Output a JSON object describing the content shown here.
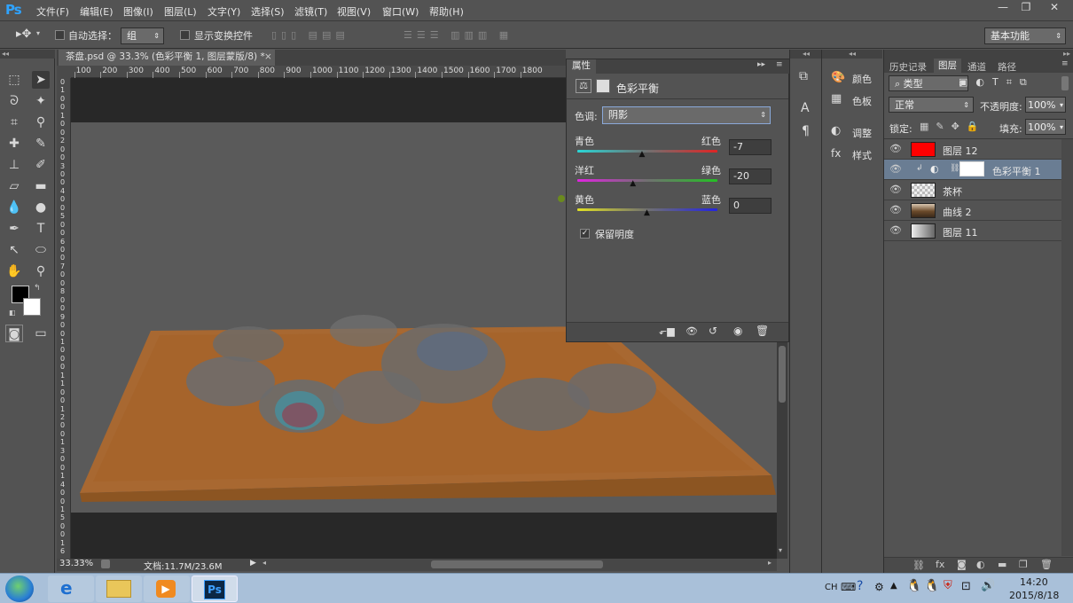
{
  "app": {
    "logo": "Ps",
    "menu": [
      "文件(F)",
      "编辑(E)",
      "图像(I)",
      "图层(L)",
      "文字(Y)",
      "选择(S)",
      "滤镜(T)",
      "视图(V)",
      "窗口(W)",
      "帮助(H)"
    ],
    "window_controls": [
      "—",
      "❐",
      "✕"
    ]
  },
  "options": {
    "auto_select_label": "自动选择：",
    "auto_select_value": "组",
    "show_transform_label": "显示变换控件",
    "workspace": "基本功能"
  },
  "document": {
    "tab_title": "茶盘.psd @ 33.3% (色彩平衡 1, 图层蒙版/8) *",
    "ruler_h": [
      "100",
      "100",
      "200",
      "300",
      "400",
      "500",
      "600",
      "700",
      "800",
      "900",
      "1000",
      "1100",
      "1200",
      "1300",
      "1400",
      "1500",
      "1600",
      "1700",
      "1800"
    ],
    "ruler_v": [
      "0",
      "1",
      "0",
      "0",
      "1",
      "0",
      "0",
      "2",
      "0",
      "0",
      "3",
      "0",
      "0",
      "4",
      "0",
      "0",
      "5",
      "0",
      "0",
      "6",
      "0",
      "0",
      "7",
      "0",
      "0",
      "8",
      "0",
      "0",
      "9",
      "0",
      "0",
      "1",
      "0",
      "0",
      "0",
      "1",
      "1",
      "0",
      "0",
      "1",
      "2",
      "0",
      "0",
      "1",
      "3",
      "0",
      "0",
      "1",
      "4",
      "0",
      "0",
      "1",
      "5",
      "0",
      "0",
      "1",
      "6"
    ],
    "zoom": "33.33%",
    "doc_size": "文档:11.7M/23.6M"
  },
  "properties": {
    "tab": "属性",
    "title": "色彩平衡",
    "tone_label": "色调:",
    "tone_value": "阴影",
    "sliders": [
      {
        "left": "青色",
        "right": "红色",
        "value": "-7",
        "level": -7
      },
      {
        "left": "洋红",
        "right": "绿色",
        "value": "-20",
        "level": -20
      },
      {
        "left": "黄色",
        "right": "蓝色",
        "value": "0",
        "level": 0
      }
    ],
    "preserve_label": "保留明度",
    "preserve_checked": true
  },
  "side_panels": [
    {
      "label": "颜色"
    },
    {
      "label": "色板"
    },
    {
      "label": "调整"
    },
    {
      "label": "样式"
    }
  ],
  "layers_panel": {
    "tabs": [
      "历史记录",
      "图层",
      "通道",
      "路径"
    ],
    "filter": "类型",
    "blend_mode": "正常",
    "opacity_label": "不透明度:",
    "opacity_value": "100%",
    "lock_label": "锁定:",
    "fill_label": "填充:",
    "fill_value": "100%",
    "layers": [
      {
        "name": "图层 12",
        "thumb": "#ff0000",
        "selected": false
      },
      {
        "name": "色彩平衡 1",
        "thumb": "adjust",
        "selected": true
      },
      {
        "name": "茶杯",
        "thumb": "check",
        "selected": false
      },
      {
        "name": "曲线 2",
        "thumb": "photo",
        "selected": false
      },
      {
        "name": "图层 11",
        "thumb": "gradient",
        "selected": false
      }
    ]
  },
  "taskbar": {
    "lang": "CH",
    "time": "14:20",
    "date": "2015/8/18"
  }
}
